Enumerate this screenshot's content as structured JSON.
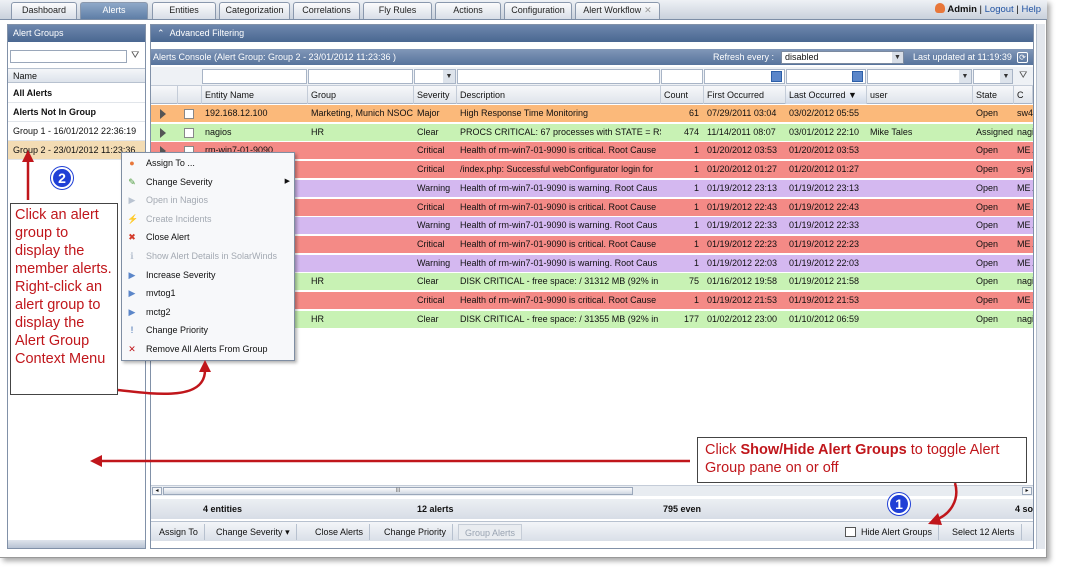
{
  "tabs": [
    {
      "label": "Dashboard"
    },
    {
      "label": "Alerts"
    },
    {
      "label": "Entities"
    },
    {
      "label": "Categorization"
    },
    {
      "label": "Correlations"
    },
    {
      "label": "Fly Rules"
    },
    {
      "label": "Actions"
    },
    {
      "label": "Configuration"
    },
    {
      "label": "Alert Workflow"
    }
  ],
  "user": {
    "name": "Admin",
    "logout": "Logout",
    "help": "Help",
    "sep": "|"
  },
  "alert_groups": {
    "title": "Alert Groups",
    "col_name": "Name",
    "items": [
      {
        "label": "All Alerts"
      },
      {
        "label": "Alerts Not In Group"
      },
      {
        "label": "Group 1 - 16/01/2012 22:36:19"
      },
      {
        "label": "Group 2 - 23/01/2012 11:23:36"
      }
    ]
  },
  "main": {
    "advanced_filtering": "Advanced Filtering",
    "console_title": "Alerts Console (Alert Group: Group 2 - 23/01/2012 11:23:36 )",
    "refresh_label": "Refresh every :",
    "refresh_value": "disabled",
    "last_updated": "Last updated at 11:19:39"
  },
  "columns": [
    "Entity Name",
    "Group",
    "Severity",
    "Description",
    "Count",
    "First Occurred",
    "Last Occurred",
    "user",
    "State",
    "C"
  ],
  "rows": [
    {
      "color": "orange",
      "entity": "192.168.12.100",
      "group": "Marketing, Munich NSOC",
      "severity": "Major",
      "description": "High Response Time Monitoring",
      "count": "61",
      "first": "07/29/2011 03:04",
      "last": "03/02/2012 05:55",
      "user": "",
      "state": "Open",
      "c": "sw4"
    },
    {
      "color": "green",
      "entity": "nagios",
      "group": "HR",
      "severity": "Clear",
      "description": "PROCS CRITICAL: 67 processes with STATE = RS",
      "count": "474",
      "first": "11/14/2011 08:07",
      "last": "03/01/2012 22:10",
      "user": "Mike Tales",
      "state": "Assigned",
      "c": "nagio"
    },
    {
      "color": "red",
      "entity": "rm-win7-01-9090",
      "group": "",
      "severity": "Critical",
      "description": "Health of rm-win7-01-9090 is critical. Root Cause",
      "count": "1",
      "first": "01/20/2012 03:53",
      "last": "01/20/2012 03:53",
      "user": "",
      "state": "Open",
      "c": "ME A"
    },
    {
      "color": "red",
      "entity": "",
      "group": "",
      "severity": "Critical",
      "description": "/index.php: Successful webConfigurator login for",
      "count": "1",
      "first": "01/20/2012 01:27",
      "last": "01/20/2012 01:27",
      "user": "",
      "state": "Open",
      "c": "syslo"
    },
    {
      "color": "purple",
      "entity": "",
      "group": "",
      "severity": "Warning",
      "description": "Health of rm-win7-01-9090 is warning. Root Caus",
      "count": "1",
      "first": "01/19/2012 23:13",
      "last": "01/19/2012 23:13",
      "user": "",
      "state": "Open",
      "c": "ME A"
    },
    {
      "color": "red",
      "entity": "",
      "group": "",
      "severity": "Critical",
      "description": "Health of rm-win7-01-9090 is critical. Root Cause",
      "count": "1",
      "first": "01/19/2012 22:43",
      "last": "01/19/2012 22:43",
      "user": "",
      "state": "Open",
      "c": "ME A"
    },
    {
      "color": "purple",
      "entity": "",
      "group": "",
      "severity": "Warning",
      "description": "Health of rm-win7-01-9090 is warning. Root Caus",
      "count": "1",
      "first": "01/19/2012 22:33",
      "last": "01/19/2012 22:33",
      "user": "",
      "state": "Open",
      "c": "ME A"
    },
    {
      "color": "red",
      "entity": "",
      "group": "",
      "severity": "Critical",
      "description": "Health of rm-win7-01-9090 is critical. Root Cause",
      "count": "1",
      "first": "01/19/2012 22:23",
      "last": "01/19/2012 22:23",
      "user": "",
      "state": "Open",
      "c": "ME A"
    },
    {
      "color": "purple",
      "entity": "",
      "group": "",
      "severity": "Warning",
      "description": "Health of rm-win7-01-9090 is warning. Root Caus",
      "count": "1",
      "first": "01/19/2012 22:03",
      "last": "01/19/2012 22:03",
      "user": "",
      "state": "Open",
      "c": "ME A"
    },
    {
      "color": "green",
      "entity": "",
      "group": "HR",
      "severity": "Clear",
      "description": "DISK CRITICAL - free space: / 31312 MB (92% in",
      "count": "75",
      "first": "01/16/2012 19:58",
      "last": "01/19/2012 21:58",
      "user": "",
      "state": "Open",
      "c": "nagio"
    },
    {
      "color": "red",
      "entity": "",
      "group": "",
      "severity": "Critical",
      "description": "Health of rm-win7-01-9090 is critical. Root Cause",
      "count": "1",
      "first": "01/19/2012 21:53",
      "last": "01/19/2012 21:53",
      "user": "",
      "state": "Open",
      "c": "ME A"
    },
    {
      "color": "green",
      "entity": "",
      "group": "HR",
      "severity": "Clear",
      "description": "DISK CRITICAL - free space: / 31355 MB (92% in",
      "count": "177",
      "first": "01/02/2012 23:00",
      "last": "01/10/2012 06:59",
      "user": "",
      "state": "Open",
      "c": "nagio"
    }
  ],
  "scroll_label": "III",
  "summary": {
    "entities": "4 entities",
    "alerts": "12 alerts",
    "events": "795 even",
    "sources": "4 so"
  },
  "actions": {
    "assign": "Assign To",
    "change_severity": "Change Severity",
    "close_alerts": "Close Alerts",
    "change_priority": "Change Priority",
    "group_alerts": "Group Alerts",
    "hide_groups": "Hide Alert Groups",
    "select_all": "Select 12 Alerts"
  },
  "context_menu": [
    {
      "label": "Assign To ...",
      "icon": "user-icon",
      "enabled": true
    },
    {
      "label": "Change Severity",
      "icon": "pencil-icon",
      "enabled": true,
      "submenu": true
    },
    {
      "label": "Open in Nagios",
      "icon": "arrow-icon",
      "enabled": false
    },
    {
      "label": "Create Incidents",
      "icon": "flash-icon",
      "enabled": false
    },
    {
      "label": "Close Alert",
      "icon": "close-icon",
      "enabled": true
    },
    {
      "label": "Show Alert Details in SolarWinds",
      "icon": "info-icon",
      "enabled": false
    },
    {
      "label": "Increase Severity",
      "icon": "arrow-icon",
      "enabled": true
    },
    {
      "label": "mvtog1",
      "icon": "arrow-icon",
      "enabled": true
    },
    {
      "label": "mctg2",
      "icon": "arrow-icon",
      "enabled": true
    },
    {
      "label": "Change Priority",
      "icon": "priority-icon",
      "enabled": true
    },
    {
      "label": "Remove All Alerts From Group",
      "icon": "remove-icon",
      "enabled": true
    }
  ],
  "annotations": {
    "callout1": "Click an alert group to display the member alerts. Right-click an alert group to display the Alert Group Context Menu",
    "callout2_pre": "Click ",
    "callout2_bold": "Show/Hide Alert Groups",
    "callout2_post": " to toggle Alert Group pane on or off",
    "badge1": "1",
    "badge2": "2"
  },
  "colors": {
    "accent_red": "#c0161b",
    "badge_blue": "#1f3fd6",
    "header_blue": "#4a6791"
  }
}
